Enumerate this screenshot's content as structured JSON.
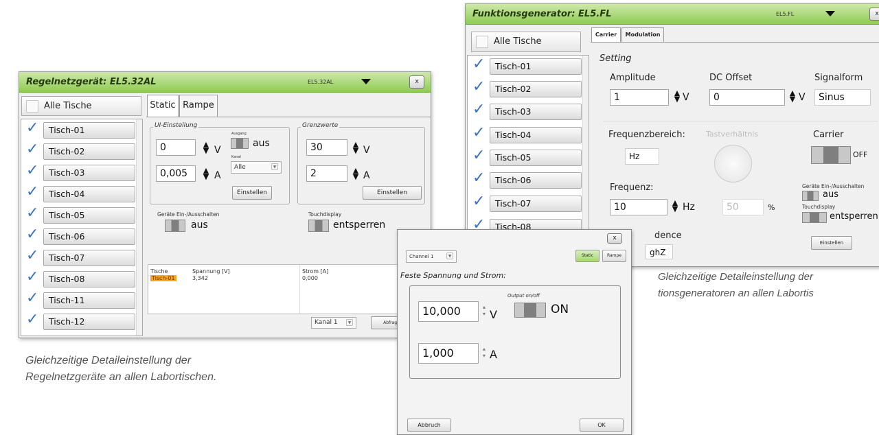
{
  "left_window": {
    "title": "Regelnetzgerät: EL5.32AL",
    "title_code": "EL5.32AL",
    "close_label": "x",
    "all_tables_label": "Alle Tische",
    "tables": [
      "Tisch-01",
      "Tisch-02",
      "Tisch-03",
      "Tisch-04",
      "Tisch-05",
      "Tisch-06",
      "Tisch-07",
      "Tisch-08",
      "Tisch-11",
      "Tisch-12"
    ],
    "tabs": [
      "Static",
      "Rampe"
    ],
    "ui_group_label": "UI-Einstellung",
    "voltage_value": "0",
    "voltage_unit": "V",
    "current_value": "0,005",
    "current_unit": "A",
    "output_label": "Ausgang",
    "output_state": "aus",
    "channel_label": "Kanal",
    "channel_value": "Alle",
    "set_button": "Einstellen",
    "limits_group_label": "Grenzwerte",
    "limit_voltage": "30",
    "limit_voltage_unit": "V",
    "limit_current": "2",
    "limit_current_unit": "A",
    "limit_set_button": "Einstellen",
    "device_onoff_label": "Geräte Ein-/Ausschalten",
    "device_state": "aus",
    "touch_label": "Touchdisplay",
    "touch_state": "entsperren",
    "table_headers": [
      "Tische",
      "Spannung [V]",
      "Strom [A]"
    ],
    "table_row": {
      "tisch": "Tisch-01",
      "spannung": "3,342",
      "strom": "0,000"
    },
    "kanal_select": "Kanal 1",
    "query_button": "Abfrage"
  },
  "right_window": {
    "title": "Funktionsgenerator: EL5.FL",
    "title_code": "EL5.FL",
    "close_label": "x",
    "all_tables_label": "Alle Tische",
    "tables": [
      "Tisch-01",
      "Tisch-02",
      "Tisch-03",
      "Tisch-04",
      "Tisch-05",
      "Tisch-06",
      "Tisch-07",
      "Tisch-08"
    ],
    "tabs": [
      "Carrier",
      "Modulation"
    ],
    "setting_label": "Setting",
    "amplitude_label": "Amplitude",
    "amplitude_value": "1",
    "amplitude_unit": "V",
    "dc_offset_label": "DC Offset",
    "dc_offset_value": "0",
    "dc_offset_unit": "V",
    "signal_label": "Signalform",
    "signal_value": "Sinus",
    "freq_range_label": "Frequenzbereich:",
    "freq_range_value": "Hz",
    "duty_label": "Tastverhältnis",
    "carrier_label": "Carrier",
    "carrier_state": "OFF",
    "freq_label": "Frequenz:",
    "freq_value": "10",
    "freq_unit": "Hz",
    "duty_value": "50",
    "duty_unit": "%",
    "device_onoff_label": "Geräte Ein-/Ausschalten",
    "device_state": "aus",
    "touch_label": "Touchdisplay",
    "touch_state": "entsperren",
    "impedance_label": "dence",
    "impedance_value": "ghZ",
    "set_button": "Einstellen"
  },
  "dialog": {
    "close_label": "x",
    "channel_select": "Channel 1",
    "static_button": "Static",
    "rampe_button": "Rampe",
    "heading": "Feste Spannung und Strom:",
    "voltage_value": "10,000",
    "voltage_unit": "V",
    "current_value": "1,000",
    "current_unit": "A",
    "output_label": "Output on/off",
    "output_state": "ON",
    "cancel_button": "Abbruch",
    "ok_button": "OK"
  },
  "captions": {
    "left_line1": "Gleichzeitige Detaileinstellung der",
    "left_line2": "Regelnetzgeräte an allen Labortischen.",
    "right_line1": "Gleichzeitige Detaileinstellung der",
    "right_line2": "tionsgeneratoren an allen Labortis"
  },
  "colors": {
    "titlebar": "#8fcb54",
    "check": "#3d72c6",
    "highlight": "#f5a623"
  }
}
